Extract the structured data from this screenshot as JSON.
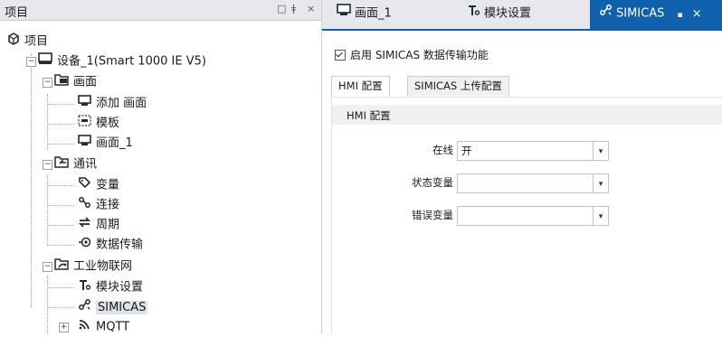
{
  "tree": {
    "title": "项目",
    "pane_buttons": {
      "auto_hide": "□",
      "pin": "ǂ",
      "close": "×"
    },
    "root": "项目",
    "device": "设备_1(Smart 1000 IE V5)",
    "screens_folder": "画面",
    "add_screen": "添加 画面",
    "template": "模板",
    "screen_1": "画面_1",
    "comm_folder": "通讯",
    "variables": "变量",
    "connections": "连接",
    "cycles": "周期",
    "data_transfer": "数据传输",
    "iiot_folder": "工业物联网",
    "module_settings": "模块设置",
    "simicas": "SIMICAS",
    "mqtt": "MQTT"
  },
  "tabs": {
    "screen_1": "画面_1",
    "module_settings": "模块设置",
    "simicas": "SIMICAS",
    "pin": "▪",
    "close": "×"
  },
  "editor": {
    "enable_label": "启用 SIMICAS 数据传输功能",
    "enable_checked": true,
    "subtabs": [
      "HMI 配置",
      "SIMICAS 上传配置"
    ],
    "section_title": "HMI 配置",
    "fields": [
      {
        "label": "在线",
        "value": "开"
      },
      {
        "label": "状态变量",
        "value": ""
      },
      {
        "label": "错误变量",
        "value": ""
      }
    ],
    "combo_arrow": "▾"
  },
  "colors": {
    "accent": "#0f60ad",
    "header_bg": "#e6e8eb",
    "section_bg": "#eef0f2"
  }
}
